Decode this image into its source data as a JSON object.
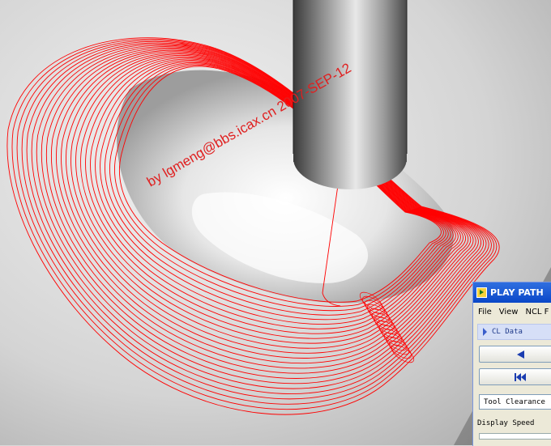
{
  "watermark": "by lgmeng@bbs.icax.cn 2007-SEP-12",
  "play_path": {
    "title": "PLAY PATH",
    "menu": [
      "File",
      "View",
      "NCL F"
    ],
    "cl_data": "CL Data",
    "step_back_icon": "step-back-icon",
    "rewind_icon": "rewind-to-start-icon",
    "tool_clearance": "Tool Clearance",
    "display_speed_label": "Display Speed"
  }
}
